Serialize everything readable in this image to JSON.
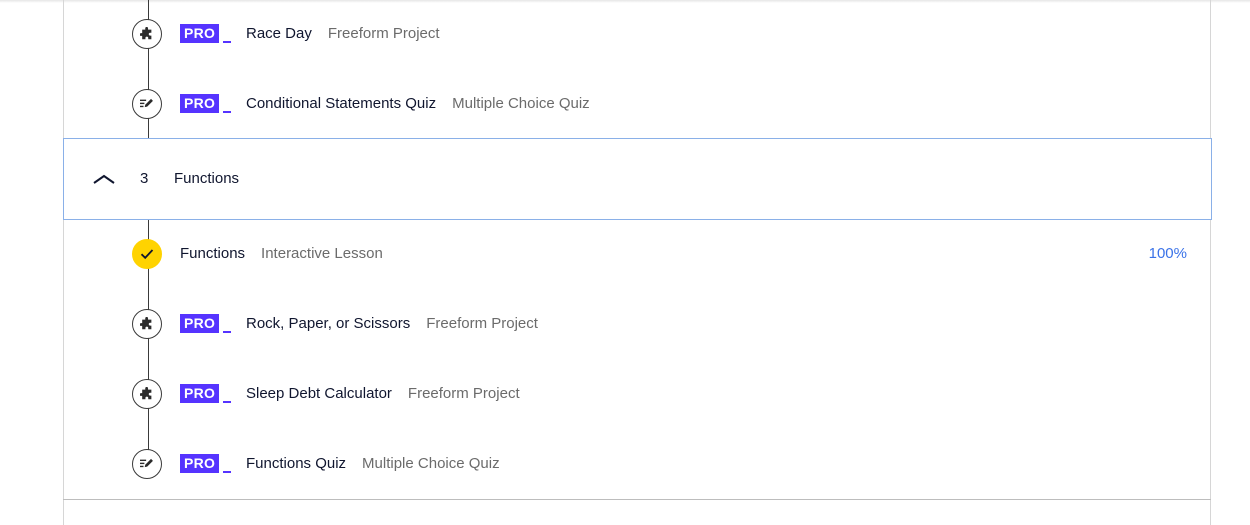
{
  "colors": {
    "pro_badge": "#5533ff",
    "complete_node": "#ffd300",
    "percent_text": "#3a72e8",
    "section_border": "#8ab0e8"
  },
  "previous_items": [
    {
      "badge": "PRO",
      "title": "Race Day",
      "type": "Freeform Project",
      "icon": "puzzle-icon"
    },
    {
      "badge": "PRO",
      "title": "Conditional Statements Quiz",
      "type": "Multiple Choice Quiz",
      "icon": "quiz-edit-icon"
    }
  ],
  "section": {
    "number": "3",
    "title": "Functions",
    "toggle_icon": "chevron-up-icon"
  },
  "items": [
    {
      "title": "Functions",
      "type": "Interactive Lesson",
      "icon": "checkmark-icon",
      "progress": "100%"
    },
    {
      "badge": "PRO",
      "title": "Rock, Paper, or Scissors",
      "type": "Freeform Project",
      "icon": "puzzle-icon"
    },
    {
      "badge": "PRO",
      "title": "Sleep Debt Calculator",
      "type": "Freeform Project",
      "icon": "puzzle-icon"
    },
    {
      "badge": "PRO",
      "title": "Functions Quiz",
      "type": "Multiple Choice Quiz",
      "icon": "quiz-edit-icon"
    }
  ]
}
